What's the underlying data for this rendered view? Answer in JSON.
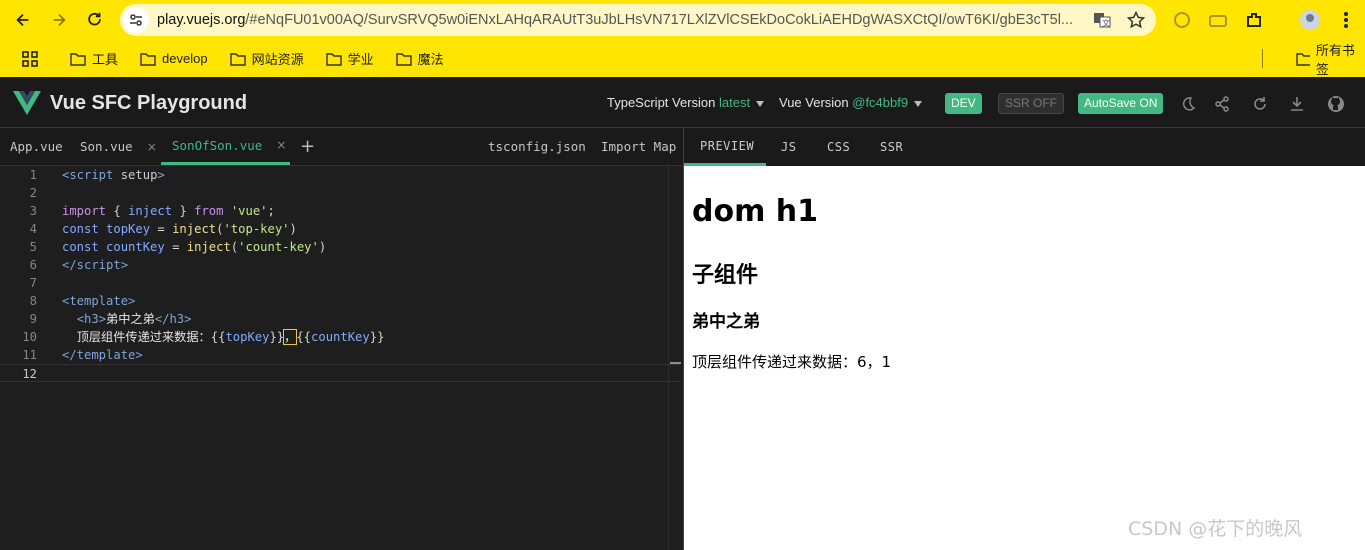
{
  "browser": {
    "url_host": "play.vuejs.org",
    "url_rest": "/#eNqFU01v00AQ/SurvSRVQ5w0iENxLAHqARAUtT3uJbLHsVN717LXlZVlCSEkDoCokLiAEHDgWASXCtQI/owT6KI/gbE3cT5l...",
    "bookmarks": [
      "工具",
      "develop",
      "网站资源",
      "学业",
      "魔法"
    ],
    "bookmarks_right": "所有书签"
  },
  "header": {
    "title": "Vue SFC Playground",
    "ts_label": "TypeScript Version",
    "ts_value": "latest",
    "vue_label": "Vue Version",
    "vue_value": "@fc4bbf9",
    "dev": "DEV",
    "ssr": "SSR OFF",
    "autosave": "AutoSave ON"
  },
  "editor_tabs": {
    "app": "App.vue",
    "son": "Son.vue",
    "sonofson": "SonOfSon.vue",
    "add": "+",
    "close": "×",
    "tsconfig": "tsconfig.json",
    "import_map": "Import Map"
  },
  "preview_tabs": [
    "PREVIEW",
    "JS",
    "CSS",
    "SSR"
  ],
  "code_lines": [
    "1",
    "2",
    "3",
    "4",
    "5",
    "6",
    "7",
    "8",
    "9",
    "10",
    "11",
    "12"
  ],
  "preview": {
    "h1": "dom h1",
    "h2": "子组件",
    "h3": "弟中之弟",
    "p": "顶层组件传递过来数据：6，1"
  },
  "watermark": "CSDN @花下的晚风",
  "colors": {
    "accent": "#42b883",
    "chrome": "#ffe500"
  }
}
